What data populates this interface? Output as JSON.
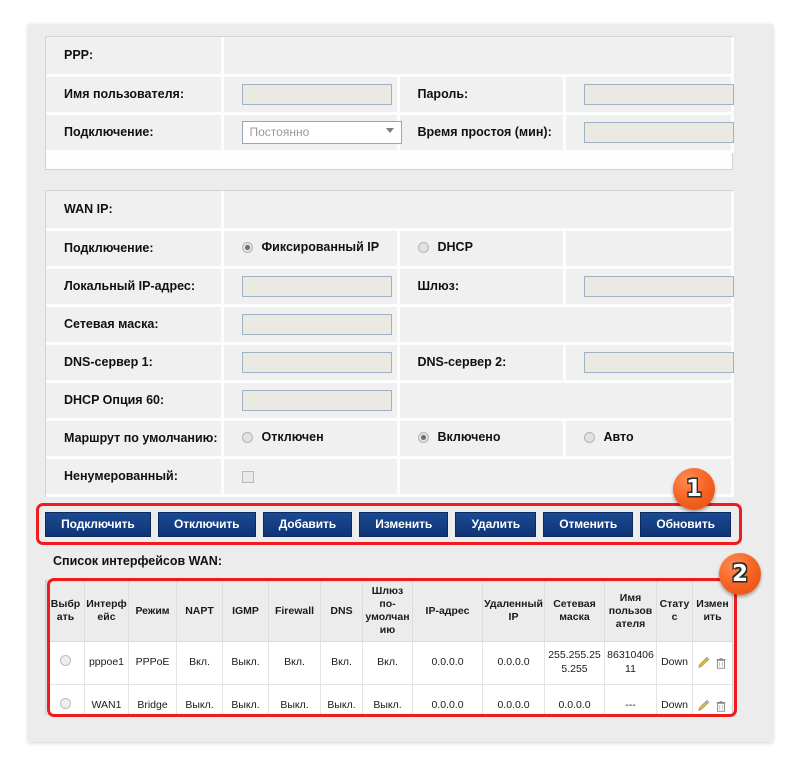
{
  "ppp_panel": {
    "section_title": "PPP:",
    "rows": [
      {
        "label": "Имя пользователя:",
        "label2": "Пароль:"
      },
      {
        "label": "Подключение:",
        "label2": "Время простоя (мин):"
      }
    ],
    "username_value": "",
    "password_value": "",
    "connection_select": "Постоянно",
    "idle_time_value": ""
  },
  "wanip_panel": {
    "section_title": "WAN IP:",
    "connection_label": "Подключение:",
    "connection_options": [
      {
        "label": "Фиксированный IP",
        "checked": true
      },
      {
        "label": "DHCP",
        "checked": false
      }
    ],
    "local_ip_label": "Локальный IP-адрес:",
    "local_ip_value": "",
    "gateway_label": "Шлюз:",
    "gateway_value": "",
    "netmask_label": "Сетевая маска:",
    "netmask_value": "",
    "dns1_label": "DNS-сервер 1:",
    "dns1_value": "",
    "dns2_label": "DNS-сервер 2:",
    "dns2_value": "",
    "dhcp_opt60_label": "DHCP Опция 60:",
    "dhcp_opt60_value": "",
    "default_route_label": "Маршрут по умолчанию:",
    "default_route_options": [
      {
        "label": "Отключен",
        "checked": false
      },
      {
        "label": "Включено",
        "checked": true
      },
      {
        "label": "Авто",
        "checked": false
      }
    ],
    "unnumbered_label": "Ненумерованный:",
    "unnumbered_checked": false
  },
  "buttons": [
    {
      "label": "Подключить",
      "name": "connect-button"
    },
    {
      "label": "Отключить",
      "name": "disconnect-button"
    },
    {
      "label": "Добавить",
      "name": "add-button"
    },
    {
      "label": "Изменить",
      "name": "modify-button"
    },
    {
      "label": "Удалить",
      "name": "delete-button"
    },
    {
      "label": "Отменить",
      "name": "cancel-button"
    },
    {
      "label": "Обновить",
      "name": "refresh-button"
    }
  ],
  "wan_list": {
    "caption": "Список интерфейсов WAN:",
    "columns": [
      "Выбрать",
      "Интерфейс",
      "Режим",
      "NAPT",
      "IGMP",
      "Firewall",
      "DNS",
      "Шлюз по-умолчанию",
      "IP-адрес",
      "Удаленный IP",
      "Сетевая маска",
      "Имя пользователя",
      "Статус",
      "Изменить"
    ],
    "rows": [
      {
        "interface": "pppoe1",
        "mode": "PPPoE",
        "napt": "Вкл.",
        "igmp": "Выкл.",
        "firewall": "Вкл.",
        "dns": "Вкл.",
        "default_gateway": "Вкл.",
        "ip_address": "0.0.0.0",
        "remote_ip": "0.0.0.0",
        "netmask": "255.255.255.255",
        "username": "8631040611",
        "status": "Down"
      },
      {
        "interface": "WAN1",
        "mode": "Bridge",
        "napt": "Выкл.",
        "igmp": "Выкл.",
        "firewall": "Выкл.",
        "dns": "Выкл.",
        "default_gateway": "Выкл.",
        "ip_address": "0.0.0.0",
        "remote_ip": "0.0.0.0",
        "netmask": "0.0.0.0",
        "username": "---",
        "status": "Down"
      }
    ],
    "row_icons": {
      "edit": "pencil-icon",
      "delete": "trash-icon"
    }
  },
  "annotations": {
    "badge1": "1",
    "badge2": "2",
    "highlight_color": "#ee1c1c",
    "badge_color": "#f4601f"
  },
  "theme": {
    "button_color": "#123a7d",
    "panel_bg": "#fdfdfd",
    "row_bg": "#f0f0f0"
  }
}
